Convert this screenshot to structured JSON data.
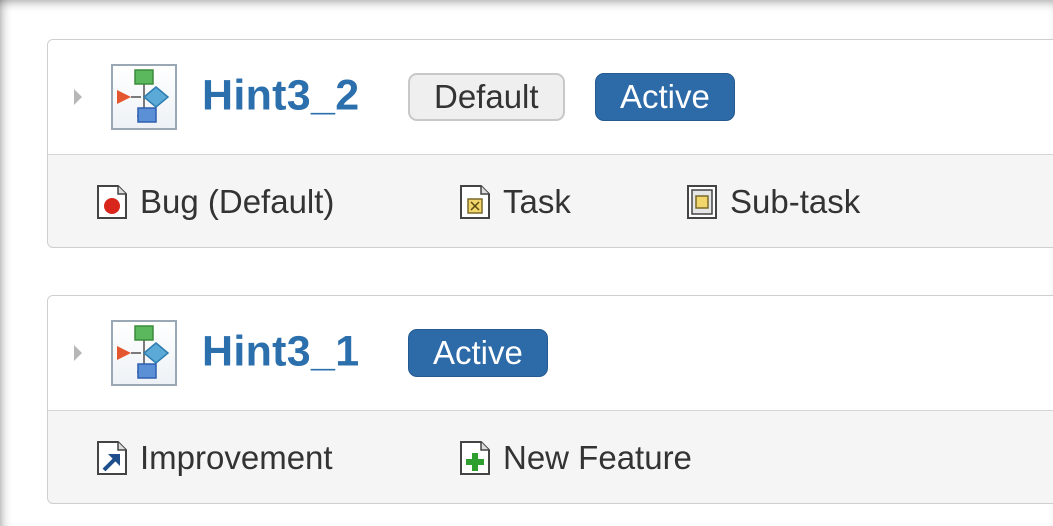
{
  "schemes": [
    {
      "name": "Hint3_2",
      "badges": {
        "default": "Default",
        "active": "Active"
      },
      "issue_types": [
        {
          "label": "Bug (Default)",
          "icon": "bug-icon"
        },
        {
          "label": "Task",
          "icon": "task-icon"
        },
        {
          "label": "Sub-task",
          "icon": "subtask-icon"
        }
      ]
    },
    {
      "name": "Hint3_1",
      "badges": {
        "active": "Active"
      },
      "issue_types": [
        {
          "label": "Improvement",
          "icon": "improvement-icon"
        },
        {
          "label": "New Feature",
          "icon": "new-feature-icon"
        }
      ]
    }
  ],
  "colors": {
    "link_blue": "#2c6fad",
    "active_badge": "#2d6aa8",
    "default_badge_bg": "#efefef",
    "bug_red": "#d9261c",
    "feature_green": "#2e9e2e"
  }
}
